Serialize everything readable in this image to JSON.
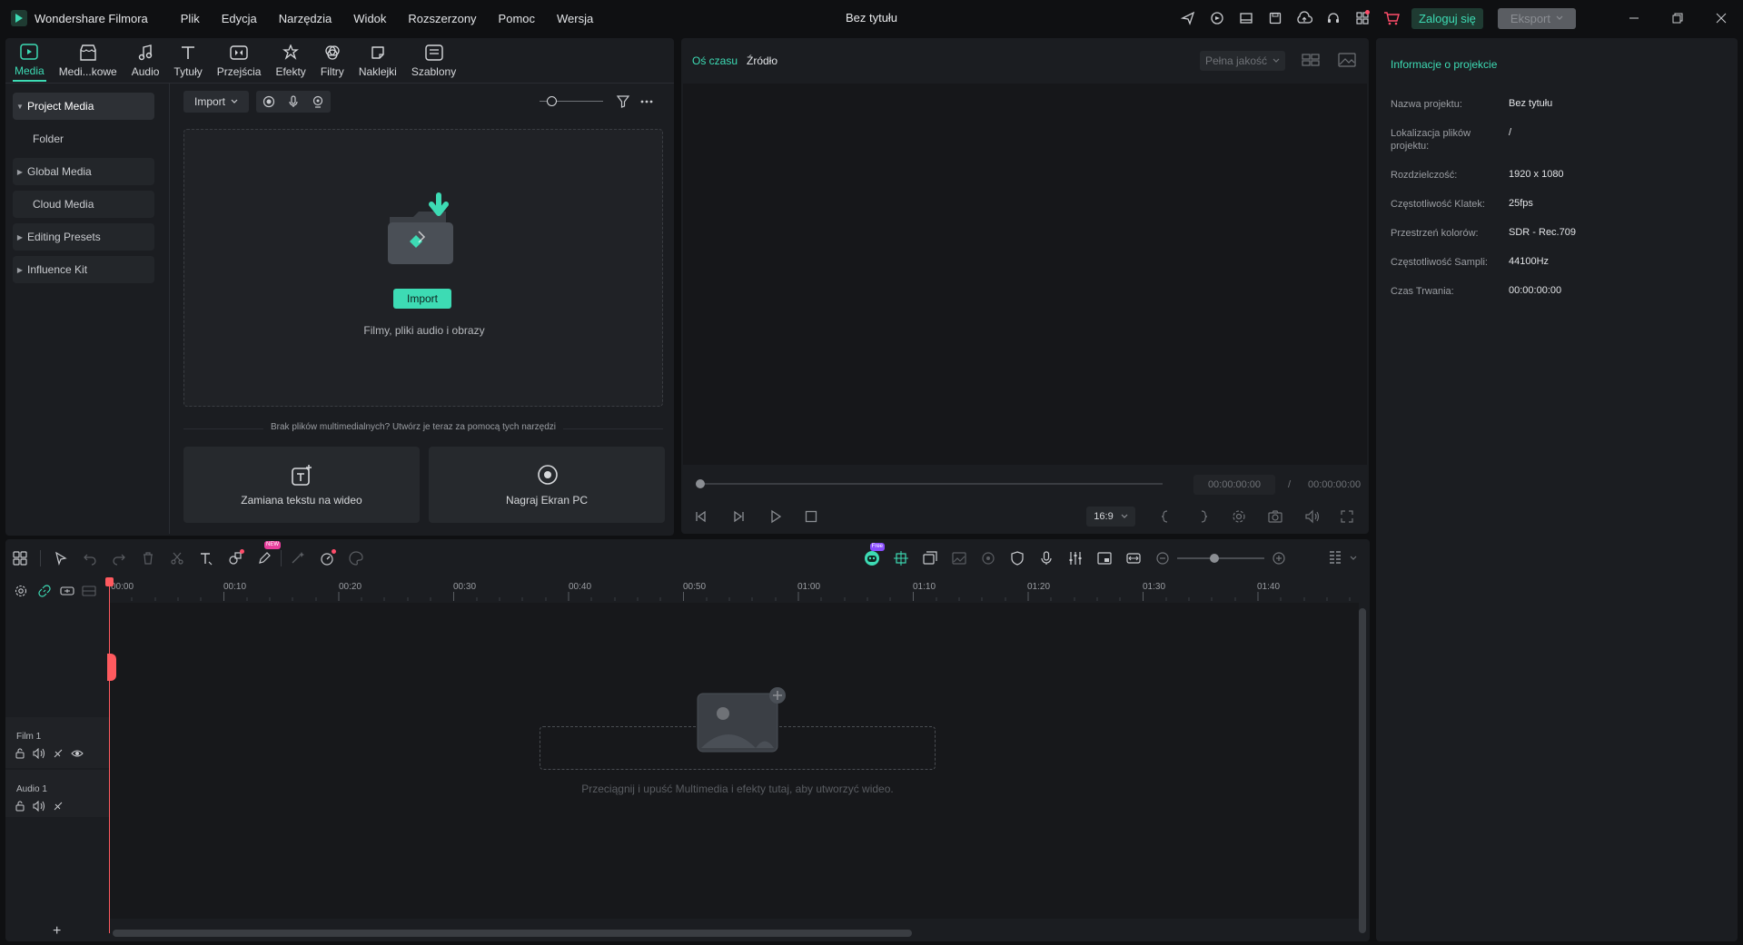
{
  "app": {
    "name": "Wondershare Filmora",
    "document_title": "Bez tytułu"
  },
  "menu": [
    "Plik",
    "Edycja",
    "Narzędzia",
    "Widok",
    "Rozszerzony",
    "Pomoc",
    "Wersja"
  ],
  "titlebar": {
    "login_label": "Zaloguj się",
    "export_label": "Eksport"
  },
  "tabs": [
    {
      "label": "Media",
      "icon": "media-icon",
      "active": true
    },
    {
      "label": "Medi...kowe",
      "icon": "stock-media-icon"
    },
    {
      "label": "Audio",
      "icon": "music-note-icon"
    },
    {
      "label": "Tytuły",
      "icon": "titles-icon"
    },
    {
      "label": "Przejścia",
      "icon": "transitions-icon"
    },
    {
      "label": "Efekty",
      "icon": "effects-icon"
    },
    {
      "label": "Filtry",
      "icon": "filters-icon"
    },
    {
      "label": "Naklejki",
      "icon": "stickers-icon"
    },
    {
      "label": "Szablony",
      "icon": "templates-icon"
    }
  ],
  "sidebar": {
    "items": [
      {
        "label": "Project Media",
        "caret": true,
        "active": true
      },
      {
        "label": "Folder",
        "caret": false
      },
      {
        "label": "Global Media",
        "caret": true
      },
      {
        "label": "Cloud Media",
        "caret": false
      },
      {
        "label": "Editing Presets",
        "caret": true
      },
      {
        "label": "Influence Kit",
        "caret": true
      }
    ]
  },
  "media": {
    "import_dropdown": "Import",
    "import_button": "Import",
    "drop_subtitle": "Filmy, pliki audio i obrazy",
    "no_files_hint": "Brak plików multimedialnych? Utwórz je teraz za pomocą tych narzędzi",
    "action_text_to_video": "Zamiana tekstu na wideo",
    "action_record_screen": "Nagraj Ekran PC"
  },
  "preview": {
    "tab_timeline": "Oś czasu",
    "tab_source": "Źródło",
    "quality": "Pełna jakość",
    "current_time": "00:00:00:00",
    "separator": "/",
    "total_time": "00:00:00:00",
    "aspect_ratio": "16:9"
  },
  "project_info": {
    "title": "Informacje o projekcie",
    "rows": [
      {
        "key": "Nazwa projektu:",
        "value": "Bez tytułu"
      },
      {
        "key": "Lokalizacja plików projektu:",
        "value": "/"
      },
      {
        "key": "Rozdzielczość:",
        "value": "1920 x 1080"
      },
      {
        "key": "Częstotliwość Klatek:",
        "value": "25fps"
      },
      {
        "key": "Przestrzeń kolorów:",
        "value": "SDR - Rec.709"
      },
      {
        "key": "Częstotliwość Sampli:",
        "value": "44100Hz"
      },
      {
        "key": "Czas Trwania:",
        "value": "00:00:00:00"
      }
    ]
  },
  "timeline": {
    "ruler": [
      "00:00",
      "00:10",
      "00:20",
      "00:30",
      "00:40",
      "00:50",
      "01:00",
      "01:10",
      "01:20",
      "01:30",
      "01:40"
    ],
    "tracks": [
      {
        "label": "Film 1"
      },
      {
        "label": "Audio 1"
      }
    ],
    "empty_hint": "Przeciągnij i upuść Multimedia i efekty tutaj, aby utworzyć wideo.",
    "badges": {
      "new": "NEW",
      "free": "Free"
    }
  },
  "colors": {
    "accent": "#3ddbb4",
    "panel": "#1b1d21",
    "background": "#0f1012",
    "playhead": "#ff5a5f"
  }
}
